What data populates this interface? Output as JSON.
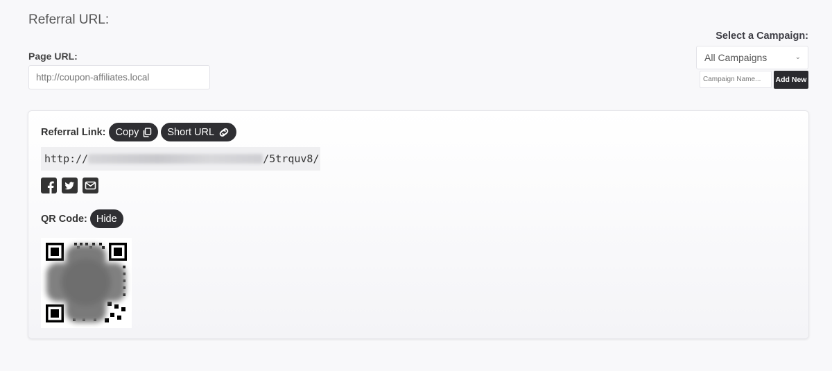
{
  "header": {
    "title": "Referral URL:"
  },
  "page_url": {
    "label": "Page URL:",
    "placeholder": "http://coupon-affiliates.local"
  },
  "campaign": {
    "label": "Select a Campaign:",
    "selected": "All Campaigns",
    "name_placeholder": "Campaign Name...",
    "add_label": "Add New"
  },
  "referral": {
    "label": "Referral Link:",
    "copy_label": "Copy",
    "short_url_label": "Short URL",
    "link_prefix": "http://",
    "link_suffix": "/5trquv8/"
  },
  "share": {
    "icons": [
      "facebook-icon",
      "twitter-icon",
      "email-icon"
    ]
  },
  "qr": {
    "label": "QR Code:",
    "hide_label": "Hide"
  },
  "colors": {
    "button_dark": "#2f2f33",
    "card_bg": "#ffffff",
    "page_bg": "#f8f8fa"
  }
}
